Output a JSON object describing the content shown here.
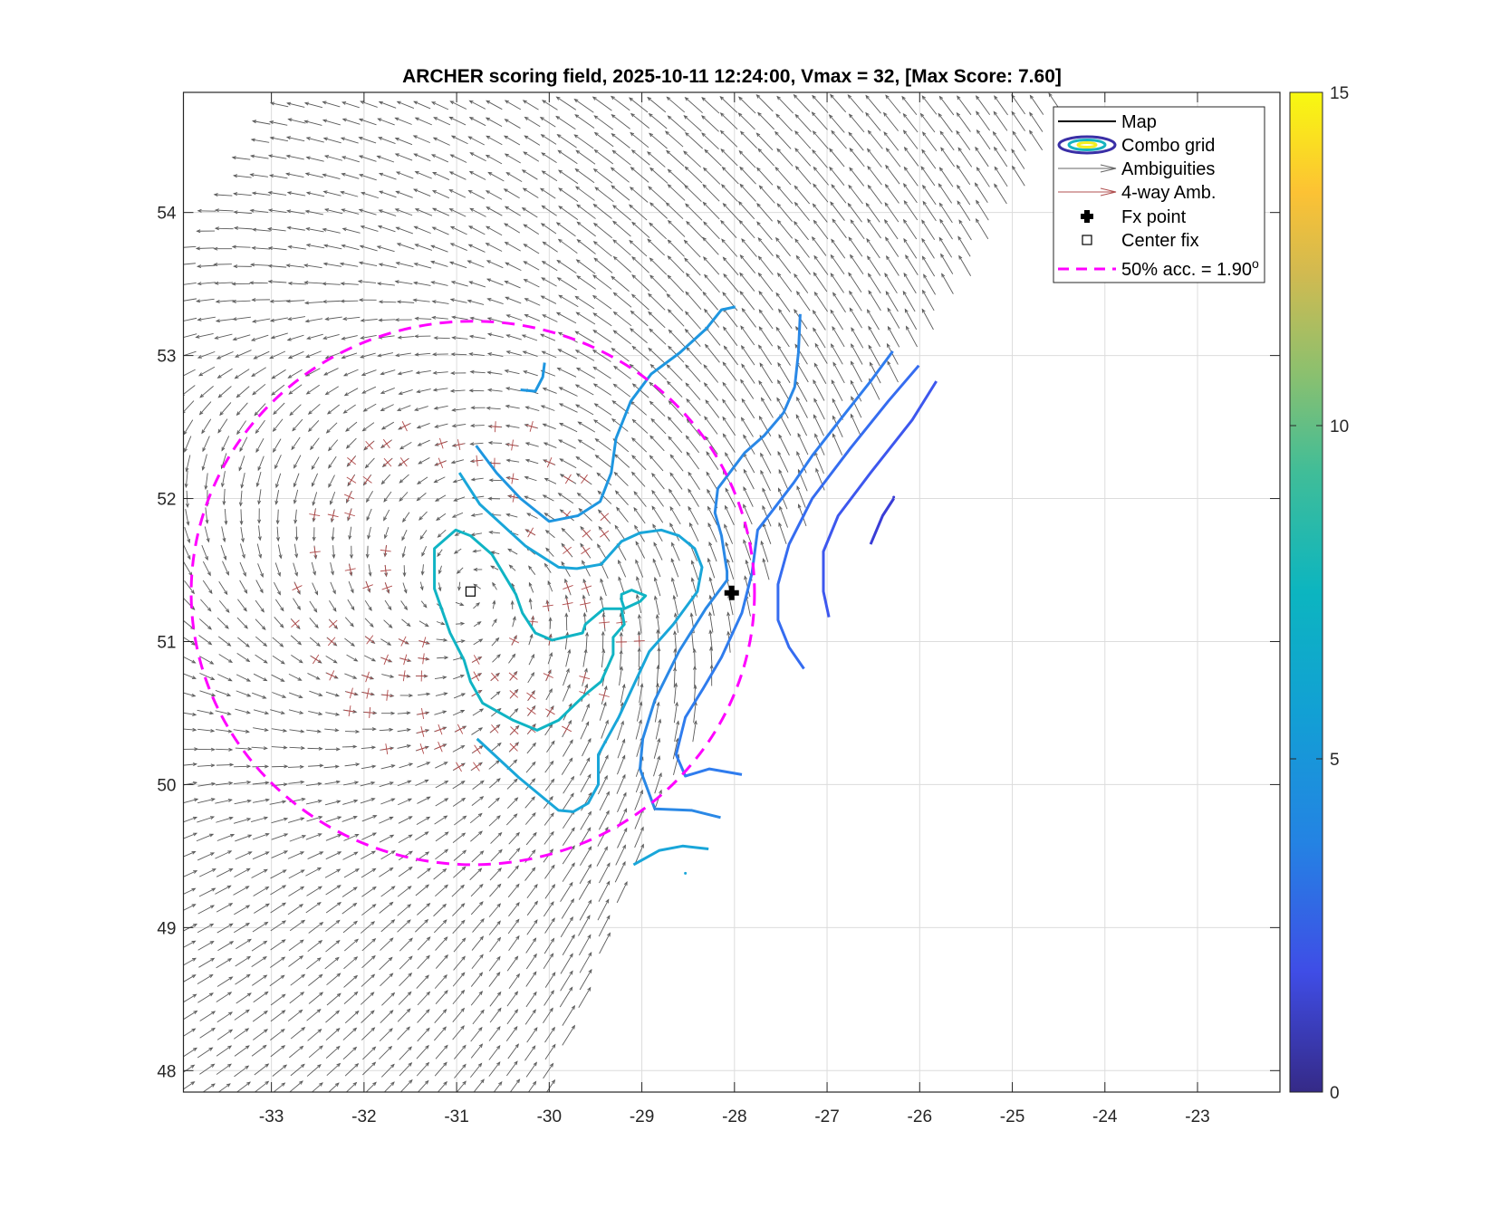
{
  "chart_data": {
    "type": "line",
    "title": "ARCHER scoring field, 2025-10-11 12:24:00, Vmax = 32, [Max Score: 7.60]",
    "xlim": [
      -33.95,
      -22.11
    ],
    "ylim": [
      47.85,
      54.84
    ],
    "xticks": [
      -33,
      -32,
      -31,
      -30,
      -29,
      -28,
      -27,
      -26,
      -25,
      -24,
      -23
    ],
    "yticks": [
      48,
      49,
      50,
      51,
      52,
      53,
      54
    ],
    "grid": true,
    "colorbar": {
      "min": 0,
      "max": 15,
      "ticks": [
        0,
        5,
        10,
        15
      ]
    },
    "legend": {
      "placement": "top-right",
      "entries": [
        {
          "label": "Map",
          "symbol": "line",
          "color": "#000000"
        },
        {
          "label": "Combo grid",
          "symbol": "ellipses"
        },
        {
          "label": "Ambiguities",
          "symbol": "arrow",
          "color": "#666666"
        },
        {
          "label": "4-way Amb.",
          "symbol": "arrow",
          "color": "#b05050"
        },
        {
          "label": "Fx point",
          "symbol": "cross",
          "color": "#000000"
        },
        {
          "label": "Center fix",
          "symbol": "square",
          "color": "#000000"
        },
        {
          "label": "50% acc. = 1.90",
          "sup": "o",
          "symbol": "dashed",
          "color": "#ff00ff"
        }
      ]
    },
    "swath_extent": [
      [
        -33.95,
        47.85
      ],
      [
        -33.95,
        53.75
      ],
      [
        -33.45,
        54.29
      ],
      [
        -32.94,
        54.84
      ],
      [
        -24.38,
        54.84
      ],
      [
        -24.69,
        54.49
      ],
      [
        -26.03,
        53.08
      ],
      [
        -27.68,
        51.48
      ],
      [
        -28.71,
        49.95
      ],
      [
        -30.0,
        47.85
      ]
    ],
    "wind_center": [
      -30.85,
      51.35
    ],
    "contours": [
      {
        "level": 6.8,
        "color": "#10b4c4",
        "closed": true,
        "points": [
          [
            -29.97,
            51.01
          ],
          [
            -29.64,
            51.06
          ],
          [
            -29.61,
            51.12
          ],
          [
            -29.41,
            51.23
          ],
          [
            -29.22,
            51.23
          ],
          [
            -29.19,
            51.12
          ],
          [
            -29.31,
            51.03
          ],
          [
            -29.31,
            50.91
          ],
          [
            -29.44,
            50.72
          ],
          [
            -29.61,
            50.63
          ],
          [
            -29.9,
            50.45
          ],
          [
            -30.13,
            50.38
          ],
          [
            -30.39,
            50.45
          ],
          [
            -30.72,
            50.57
          ],
          [
            -30.85,
            50.72
          ],
          [
            -30.92,
            50.87
          ],
          [
            -31.07,
            51.06
          ],
          [
            -31.24,
            51.37
          ],
          [
            -31.24,
            51.65
          ],
          [
            -31.01,
            51.78
          ],
          [
            -30.85,
            51.74
          ],
          [
            -30.62,
            51.61
          ],
          [
            -30.36,
            51.33
          ],
          [
            -30.29,
            51.2
          ],
          [
            -30.15,
            51.06
          ]
        ]
      },
      {
        "level": 6.8,
        "color": "#10b4c4",
        "closed": true,
        "points": [
          [
            -29.22,
            51.33
          ],
          [
            -29.11,
            51.36
          ],
          [
            -28.96,
            51.32
          ],
          [
            -29.02,
            51.28
          ],
          [
            -29.19,
            51.23
          ],
          [
            -29.22,
            51.29
          ]
        ]
      },
      {
        "level": 6.0,
        "color": "#19a6d9",
        "closed": false,
        "points": [
          [
            -30.78,
            50.32
          ],
          [
            -30.33,
            50.05
          ],
          [
            -29.9,
            49.82
          ],
          [
            -29.74,
            49.81
          ],
          [
            -29.58,
            49.87
          ],
          [
            -29.47,
            50.0
          ],
          [
            -29.47,
            50.21
          ],
          [
            -29.25,
            50.47
          ],
          [
            -28.92,
            50.93
          ],
          [
            -28.66,
            51.12
          ],
          [
            -28.4,
            51.35
          ],
          [
            -28.35,
            51.52
          ],
          [
            -28.43,
            51.65
          ],
          [
            -28.6,
            51.74
          ],
          [
            -28.79,
            51.78
          ],
          [
            -29.02,
            51.76
          ],
          [
            -29.22,
            51.7
          ],
          [
            -29.44,
            51.54
          ],
          [
            -29.7,
            51.51
          ],
          [
            -29.9,
            51.52
          ],
          [
            -30.26,
            51.67
          ],
          [
            -30.75,
            51.96
          ],
          [
            -30.97,
            52.18
          ]
        ]
      },
      {
        "level": 6.0,
        "color": "#19a6d9",
        "closed": false,
        "points": [
          [
            -29.09,
            49.44
          ],
          [
            -28.81,
            49.54
          ],
          [
            -28.56,
            49.57
          ],
          [
            -28.28,
            49.55
          ]
        ]
      },
      {
        "level": 5.5,
        "color": "#1e96e0",
        "closed": false,
        "points": [
          [
            -30.79,
            52.37
          ],
          [
            -30.57,
            52.18
          ],
          [
            -30.31,
            52.0
          ],
          [
            -30.0,
            51.84
          ],
          [
            -29.69,
            51.88
          ],
          [
            -29.45,
            51.98
          ],
          [
            -29.33,
            52.18
          ],
          [
            -29.28,
            52.42
          ],
          [
            -29.12,
            52.68
          ],
          [
            -28.9,
            52.87
          ],
          [
            -28.59,
            53.02
          ],
          [
            -28.3,
            53.19
          ],
          [
            -28.14,
            53.32
          ],
          [
            -27.99,
            53.34
          ]
        ]
      },
      {
        "level": 5.5,
        "color": "#1e96e0",
        "closed": false,
        "points": [
          [
            -30.31,
            52.76
          ],
          [
            -30.15,
            52.75
          ],
          [
            -30.07,
            52.85
          ],
          [
            -30.05,
            52.95
          ]
        ]
      },
      {
        "level": 5.0,
        "color": "#2a88e6",
        "closed": false,
        "points": [
          [
            -27.29,
            53.29
          ],
          [
            -27.31,
            53.02
          ],
          [
            -27.35,
            52.78
          ],
          [
            -27.47,
            52.6
          ],
          [
            -27.68,
            52.44
          ],
          [
            -27.89,
            52.32
          ],
          [
            -28.18,
            52.07
          ],
          [
            -28.21,
            51.9
          ],
          [
            -28.14,
            51.74
          ],
          [
            -28.08,
            51.49
          ],
          [
            -28.08,
            51.43
          ],
          [
            -28.31,
            51.23
          ],
          [
            -28.6,
            50.93
          ],
          [
            -28.86,
            50.59
          ],
          [
            -28.99,
            50.32
          ],
          [
            -29.02,
            50.11
          ],
          [
            -28.86,
            49.83
          ],
          [
            -28.46,
            49.82
          ],
          [
            -28.15,
            49.77
          ]
        ]
      },
      {
        "level": 4.5,
        "color": "#2f7cee",
        "closed": false,
        "points": [
          [
            -26.29,
            53.03
          ],
          [
            -26.53,
            52.82
          ],
          [
            -26.86,
            52.55
          ],
          [
            -27.16,
            52.3
          ],
          [
            -27.36,
            52.11
          ],
          [
            -27.75,
            51.78
          ],
          [
            -27.81,
            51.48
          ],
          [
            -27.92,
            51.2
          ],
          [
            -28.14,
            50.89
          ],
          [
            -28.34,
            50.67
          ],
          [
            -28.53,
            50.47
          ],
          [
            -28.63,
            50.21
          ],
          [
            -28.53,
            50.06
          ],
          [
            -28.27,
            50.11
          ],
          [
            -27.92,
            50.07
          ]
        ]
      },
      {
        "level": 4.0,
        "color": "#356cf0",
        "closed": false,
        "points": [
          [
            -26.01,
            52.93
          ],
          [
            -26.34,
            52.68
          ],
          [
            -26.75,
            52.35
          ],
          [
            -27.16,
            52.0
          ],
          [
            -27.41,
            51.68
          ],
          [
            -27.53,
            51.4
          ],
          [
            -27.53,
            51.15
          ],
          [
            -27.41,
            50.96
          ],
          [
            -27.25,
            50.81
          ]
        ]
      },
      {
        "level": 3.5,
        "color": "#3d57ee",
        "closed": false,
        "points": [
          [
            -25.82,
            52.82
          ],
          [
            -26.08,
            52.55
          ],
          [
            -26.53,
            52.18
          ],
          [
            -26.88,
            51.88
          ],
          [
            -27.04,
            51.63
          ],
          [
            -27.04,
            51.35
          ],
          [
            -26.98,
            51.17
          ]
        ]
      },
      {
        "level": 2.5,
        "color": "#3a3dd6",
        "closed": false,
        "points": [
          [
            -26.53,
            51.68
          ],
          [
            -26.4,
            51.88
          ],
          [
            -26.28,
            52.0
          ]
        ]
      }
    ],
    "accuracy_circle": {
      "center": [
        -30.825,
        51.34
      ],
      "radius_deg_lat": 1.9,
      "color": "#ff00ff"
    },
    "fx_point": [
      -28.03,
      51.34
    ],
    "center_fix": [
      -30.85,
      51.35
    ]
  }
}
